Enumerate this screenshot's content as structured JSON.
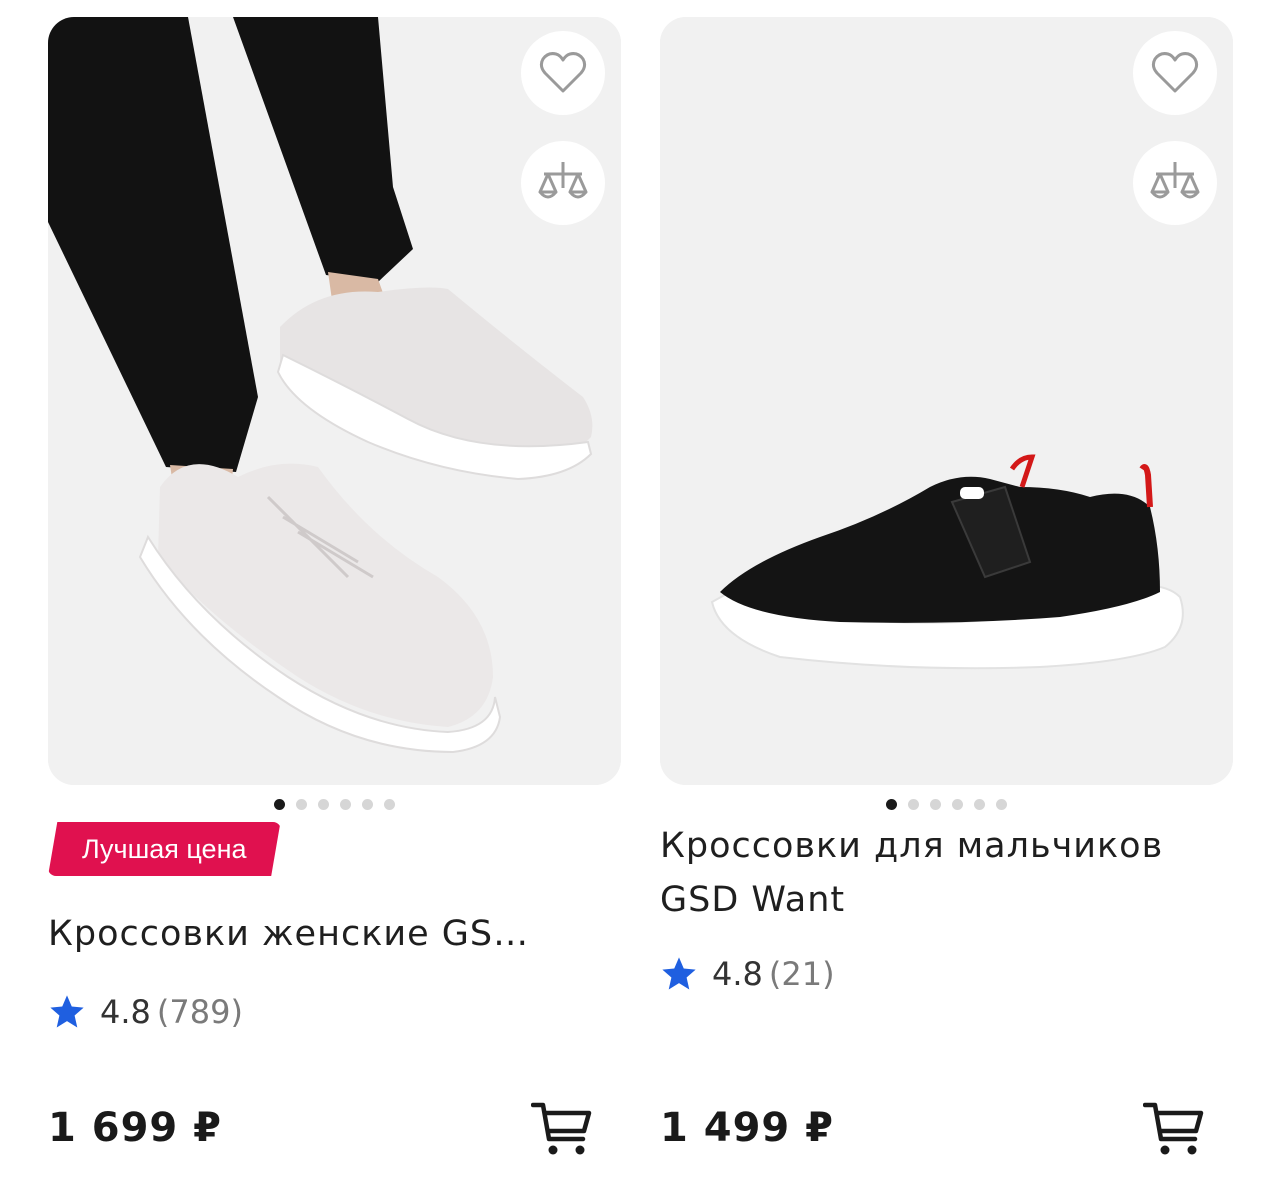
{
  "products": [
    {
      "badge": "Лучшая цена",
      "title": "Кроссовки женские GS…",
      "rating": "4.8",
      "rating_count": "(789)",
      "price": "1 699 ₽",
      "slides": 6,
      "active_slide": 0,
      "icons": [
        "heart-icon",
        "compare-scales-icon",
        "cart-icon",
        "star-icon"
      ]
    },
    {
      "title": "Кроссовки для мальчиков GSD Want",
      "rating": "4.8",
      "rating_count": "(21)",
      "price": "1 499 ₽",
      "slides": 6,
      "active_slide": 0,
      "icons": [
        "heart-icon",
        "compare-scales-icon",
        "cart-icon",
        "star-icon"
      ]
    }
  ],
  "colors": {
    "badge": "#e0114f",
    "star": "#1f5fe0",
    "image_bg": "#efefef",
    "text": "#1f1f1f"
  }
}
